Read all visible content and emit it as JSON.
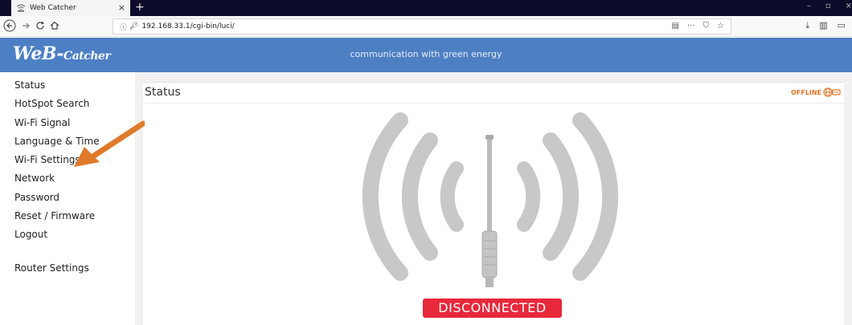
{
  "browser": {
    "tab_title": "Web Catcher",
    "tab_close": "×",
    "new_tab": "+",
    "url_info_icon": "ⓘ",
    "url": "192.168.33.1/cgi-bin/luci/",
    "nav_icons": [
      "back-icon",
      "forward-icon",
      "reload-icon",
      "home-icon"
    ],
    "url_actions_icons": [
      "reader-view-icon",
      "more-icon",
      "pocket-icon",
      "bookmark-star-icon"
    ],
    "toolbar_icons": [
      "download-icon",
      "library-icon",
      "sidebar-icon"
    ],
    "window_buttons": [
      "minimize-icon",
      "maximize-icon",
      "close-icon"
    ]
  },
  "header": {
    "logo_main": "WeB-",
    "logo_second": "Catcher",
    "tagline": "communication with green energy",
    "background": "#4d7fc3"
  },
  "sidebar": {
    "items": [
      {
        "label": "Status"
      },
      {
        "label": "HotSpot Search"
      },
      {
        "label": "Wi-Fi Signal"
      },
      {
        "label": "Language & Time"
      },
      {
        "label": "Wi-Fi Settings"
      },
      {
        "label": "Network"
      },
      {
        "label": "Password"
      },
      {
        "label": "Reset / Firmware"
      },
      {
        "label": "Logout"
      },
      {
        "label": "Router Settings"
      }
    ]
  },
  "panel": {
    "title": "Status",
    "offline_label": "OFFLINE",
    "connection_status": "DISCONNECTED",
    "status_color": "#e8283b",
    "offline_color": "#e8732a",
    "annotation": "orange-arrow-pointing-to-wifi-settings"
  }
}
